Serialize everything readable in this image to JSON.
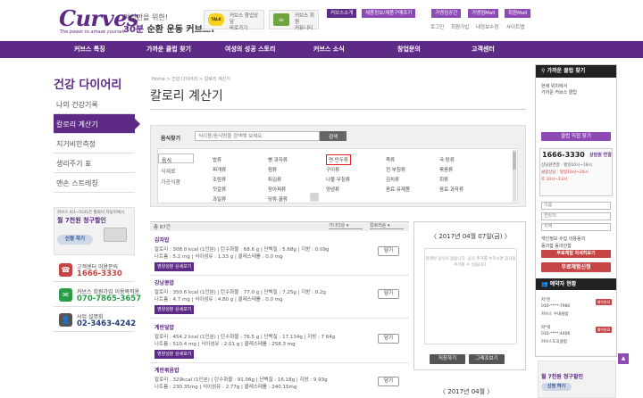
{
  "header": {
    "logo": "Curves",
    "logo_sub": "The power to amaze yourself",
    "slogan_line1": "여성만을 위한!",
    "slogan_line2_bold": "30분",
    "slogan_line2": " 순환 운동 커브스!",
    "promo_talk": [
      "커브스 창업상담",
      "바로가기"
    ],
    "promo_cafe": [
      "커브스 회원",
      "커뮤니티"
    ],
    "top_tabs": [
      "커브스소개",
      "제품정보/제품구매조기",
      "가맹점공간",
      "가맹점Mall",
      "회원Mall"
    ],
    "util_links": [
      "로그인",
      "회원가입",
      "내정보수정",
      "사이트맵"
    ]
  },
  "gnb": [
    "커브스 특징",
    "가까운 클럽 찾기",
    "여성의 성공 스토리",
    "커브스 소식",
    "창업문의",
    "고객센터"
  ],
  "sidebar": {
    "title": "건강 다이어리",
    "items": [
      "나의 건강기록",
      "칼로리 계산기",
      "지거비만측정",
      "생리주기 표",
      "맨손 스트레칭"
    ],
    "banner": {
      "small": "커브스 4/1~5/31은 월회비 자동이체시",
      "big": "월 7천원 청구할인",
      "button": "신청 하기"
    },
    "contacts": [
      {
        "label": "고객센터 이용문의",
        "number": "1666-3330",
        "color": "#c54444",
        "icon": "☎"
      },
      {
        "label": "커브스 회원가입 이용목적용",
        "number": "070-7865-3657",
        "color": "#2a9d48",
        "icon": "✉"
      },
      {
        "label": "사업 설명회",
        "number": "02-3463-4242",
        "color": "#555555",
        "icon": "👤"
      }
    ]
  },
  "breadcrumb": "Home > 건강 다이어리 > 칼로리 계산기",
  "page_title": "칼로리 계산기",
  "search": {
    "label": "음식찾기",
    "placeholder": "식이용/음식명을 검색해 보세요.",
    "button": "검색"
  },
  "category_tabs": [
    "음식",
    "식재료",
    "가공식품"
  ],
  "categories": [
    [
      "밥류",
      "빵·과자류",
      "면·만두류",
      "죽류",
      "국·탕류"
    ],
    [
      "찌개류",
      "찜류",
      "구이류",
      "전·부침류",
      "볶음류"
    ],
    [
      "조림류",
      "튀김류",
      "나물·무침류",
      "김치류",
      "회류"
    ],
    [
      "젓갈류",
      "장아찌류",
      "양념류",
      "음료·유제품",
      "음료·과자류"
    ],
    [
      "과일류",
      "당류·꿀류",
      "",
      "",
      ""
    ]
  ],
  "results": {
    "count": "총 87건",
    "sort1": "가나다순",
    "sort2": "칼로리순",
    "items": [
      {
        "name": "감자밥",
        "line1": "칼로리 : 308.0 kcal (1인분) | 탄수화물 : 68.6 g | 단백질 : 5.68g | 지방 : 0.09g",
        "line2": "나트륨 : 5.2 mg | 식이섬유 : 1.33 g | 콜레스테롤 : 0.0 mg"
      },
      {
        "name": "강낭콩밥",
        "line1": "칼로리 : 350.6 kcal (1인분) | 탄수화물 : 77.0 g | 단백질 : 7.25g | 지방 : 0.2g",
        "line2": "나트륨 : 4.7 mg | 식이섬유 : 4.80 g | 콜레스테롤 : 0.0 mg"
      },
      {
        "name": "계란덮밥",
        "line1": "칼로리 : 454.2 kcal (1인분) | 탄수화물 : 76.5 g | 단백질 : 17.134g | 지방 : 7.64g",
        "line2": "나트륨 : 510.4 mg | 식이섬유 : 2.01 g | 콜레스테롤 : 258.3 mg"
      },
      {
        "name": "계란볶음밥",
        "line1": "칼로리 : 329kcal (1인분) | 탄수화물 : 91.06g | 단백질 : 16.18g | 지방 : 9.93g",
        "line2": "나트륨 : 230.35mg | 식이섬유 : 2.77g | 콜레스테롤 : 240.15mg"
      }
    ],
    "detail_button": "영양성분 상세보기",
    "add_button": "담기"
  },
  "diary": {
    "date": "2017년 04월 07일(금)",
    "message": "검색된 음식이 없습니다. 음식 추가를 누르시면 음식을 추가할 수 있습니다.",
    "save_button": "저장하기",
    "graph_button": "그래프보기",
    "date2": "2017년 04월"
  },
  "right": {
    "club_title": "가까운 클럽 찾기",
    "club_text": [
      "현재 위치에서",
      "가까운 커브스 클럽"
    ],
    "club_button": "클럽 직접 찾기",
    "phone": "1666-3330",
    "phone_note": "상담원 연결",
    "hours": [
      "상담원연결 : 평일10시~18시",
      "클럽상담 : 평일10시~20시",
      "토 10시~13시"
    ],
    "fields": [
      "이름",
      "연락처",
      "지역"
    ],
    "agree_text": [
      "개인정보 수집 이용동의",
      "동의함 동의안함"
    ],
    "btn_consult": "무료체험 자세히보기",
    "btn_trial": "무료체험신청",
    "resv_title": "예약자 현황",
    "resv": [
      {
        "name": "지*진",
        "phone": "010-****-7980",
        "club": "커브스 수내클럽",
        "badge": "예약완료"
      },
      {
        "name": "박*희",
        "phone": "010-****-4406",
        "club": "커브스도곡클럽",
        "badge": "예약완료"
      }
    ],
    "bottom_banner": "월 7천원 청구할인",
    "bottom_banner_btn": "신청 하기"
  },
  "colors": {
    "brand_purple": "#5d2a86",
    "accent_purple": "#8e4ab4",
    "highlight_red": "#e52020"
  }
}
